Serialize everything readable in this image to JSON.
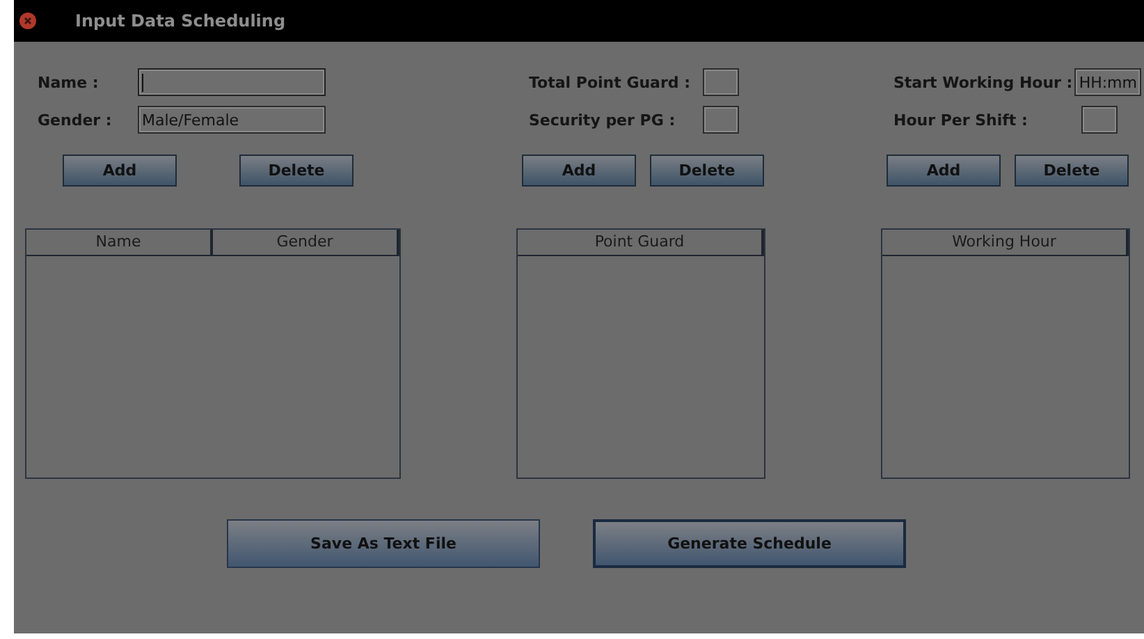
{
  "window": {
    "title": "Input Data Scheduling"
  },
  "sections": [
    {
      "fields": [
        {
          "label": "Name :",
          "kind": "wide",
          "focused": true
        },
        {
          "label": "Gender :",
          "value": "Male/Female",
          "kind": "wide",
          "focused": false
        }
      ],
      "buttons": [
        "Add",
        "Delete"
      ],
      "table": {
        "columns": [
          "Name",
          "Gender"
        ]
      }
    },
    {
      "fields": [
        {
          "label": "Total Point Guard :",
          "kind": "small",
          "focused": false
        },
        {
          "label": "Security per PG :",
          "kind": "small",
          "focused": false
        }
      ],
      "buttons": [
        "Add",
        "Delete"
      ],
      "table": {
        "columns": [
          "Point Guard"
        ]
      }
    },
    {
      "fields": [
        {
          "label": "Start Working Hour :",
          "value": "HH:mm",
          "kind": "small",
          "focused": false
        },
        {
          "label": "Hour Per Shift :",
          "kind": "small",
          "focused": false
        }
      ],
      "buttons": [
        "Add",
        "Delete"
      ],
      "table": {
        "columns": [
          "Working Hour"
        ]
      }
    }
  ],
  "actions": [
    {
      "label": "Save As Text File",
      "focused": false
    },
    {
      "label": "Generate Schedule",
      "focused": true
    }
  ]
}
